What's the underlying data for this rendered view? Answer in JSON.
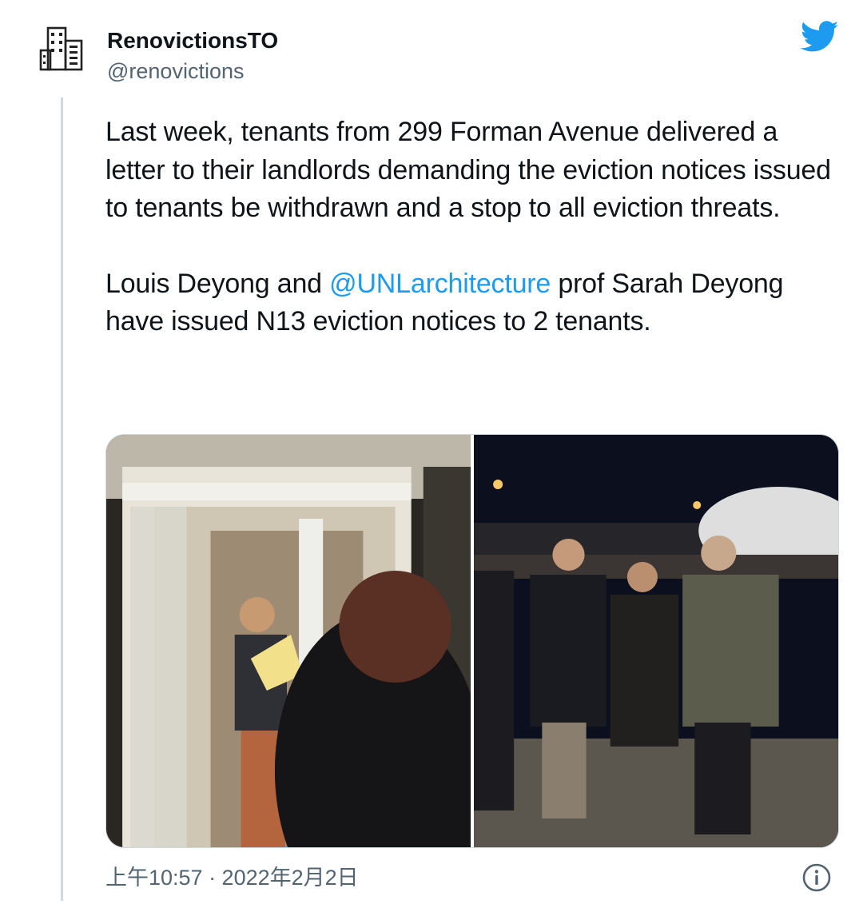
{
  "author": {
    "display_name": "RenovictionsTO",
    "handle": "@renovictions",
    "avatar_icon": "building-icon"
  },
  "brand_icon": "twitter-bird-icon",
  "brand_color": "#1d9bf0",
  "tweet": {
    "paragraph1": "Last week, tenants from 299 Forman Avenue delivered a letter to their landlords demanding the eviction notices issued to tenants be withdrawn and a stop to all eviction threats.",
    "p2_before": "Louis Deyong and ",
    "p2_mention": "@UNLarchitecture",
    "p2_after": " prof Sarah Deyong have issued N13 eviction notices to 2 tenants."
  },
  "media": {
    "count": 2
  },
  "footer": {
    "timestamp": "上午10:57 · 2022年2月2日",
    "info_icon": "info-icon"
  }
}
